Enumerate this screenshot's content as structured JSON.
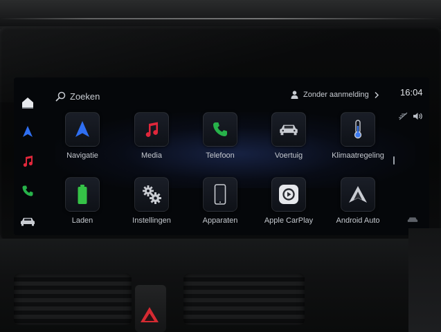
{
  "screen": {
    "search": {
      "label": "Zoeken",
      "icon": "search-icon"
    },
    "account": {
      "label": "Zonder aanmelding",
      "icon": "person-icon",
      "chevron": "chevron-right-icon"
    },
    "clock": {
      "time": "16:04"
    },
    "status": {
      "icons": [
        "no-signal-icon",
        "speaker-icon"
      ]
    },
    "rail": [
      {
        "icon": "home-icon",
        "color": "#e6e8ec"
      },
      {
        "icon": "navigation-arrow-icon",
        "color": "#2f6ff2"
      },
      {
        "icon": "music-note-icon",
        "color": "#e0273b"
      },
      {
        "icon": "phone-icon",
        "color": "#27b24a"
      },
      {
        "icon": "car-icon",
        "color": "#c9ccd2"
      }
    ],
    "apps": [
      {
        "label": "Navigatie",
        "icon": "navigation-arrow-icon",
        "color": "#2f6ff2"
      },
      {
        "label": "Media",
        "icon": "music-note-icon",
        "color": "#e0273b"
      },
      {
        "label": "Telefoon",
        "icon": "phone-icon",
        "color": "#27b24a"
      },
      {
        "label": "Voertuig",
        "icon": "car-icon",
        "color": "#c9ccd2"
      },
      {
        "label": "Klimaatregeling",
        "icon": "thermometer-icon",
        "color": "#3d7bf0"
      },
      {
        "label": "Laden",
        "icon": "battery-icon",
        "color": "#35c247"
      },
      {
        "label": "Instellingen",
        "icon": "gears-icon",
        "color": "#c9ccd2"
      },
      {
        "label": "Apparaten",
        "icon": "smartphone-icon",
        "color": "#c9ccd2"
      },
      {
        "label": "Apple CarPlay",
        "icon": "carplay-icon",
        "color": "#e6e8ec"
      },
      {
        "label": "Android Auto",
        "icon": "android-auto-icon",
        "color": "#c9ccd2"
      }
    ]
  },
  "colors": {
    "screen_background": "#05070a",
    "text": "#c5c9cf",
    "hazard": "#d62a32"
  }
}
